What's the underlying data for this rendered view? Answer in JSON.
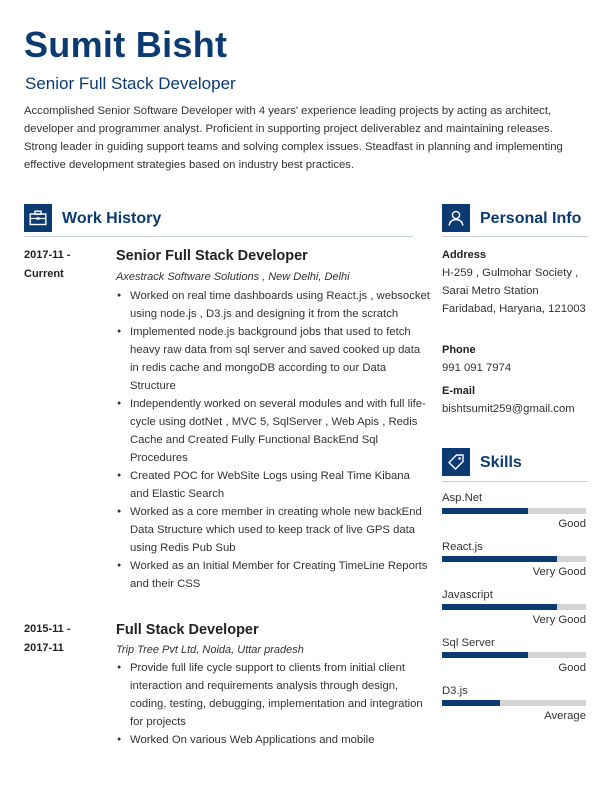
{
  "header": {
    "name": "Sumit Bisht",
    "title": "Senior Full Stack Developer",
    "summary": "Accomplished Senior Software Developer with 4 years' experience leading projects by acting as architect, developer and programmer analyst. Proficient in supporting project deliverablez and maintaining releases. Strong leader in guiding support teams and solving complex issues. Steadfast in planning and implementing effective development strategies based on industry best practices."
  },
  "work_history": {
    "heading": "Work History",
    "icon": "briefcase-icon",
    "jobs": [
      {
        "date_line1": "2017-11 -",
        "date_line2": "Current",
        "title": "Senior Full Stack Developer",
        "company": "Axestrack Software Solutions , New Delhi, Delhi",
        "bullets": [
          "Worked on real time dashboards using React.js , websocket using node.js , D3.js and designing it from the scratch",
          "Implemented node.js background jobs that used to fetch heavy raw data from sql server and saved cooked up data in redis cache and mongoDB according to our Data Structure",
          "Independently worked on several modules and with full life-cycle using dotNet , MVC 5, SqlServer , Web Apis , Redis Cache and Created Fully Functional BackEnd Sql Procedures",
          "Created POC for WebSite Logs using Real Time Kibana and Elastic Search",
          "Worked as a core member in creating whole new backEnd Data Structure which used to keep track of live GPS data using Redis Pub Sub",
          "Worked as an Initial Member for Creating TimeLine Reports and their CSS"
        ]
      },
      {
        "date_line1": "2015-11 -",
        "date_line2": "2017-11",
        "title": "Full Stack Developer",
        "company": "Trip Tree Pvt Ltd, Noida, Uttar pradesh",
        "bullets": [
          "Provide full life cycle support to clients from initial client interaction and requirements analysis through design, coding, testing, debugging, implementation and integration for projects",
          "Worked On various Web Applications and mobile"
        ]
      }
    ]
  },
  "personal_info": {
    "heading": "Personal Info",
    "icon": "user-icon",
    "address_label": "Address",
    "address_value": "H-259 , Gulmohar Society , Sarai Metro Station Faridabad, Haryana, 121003",
    "phone_label": "Phone",
    "phone_value": "991 091 7974",
    "email_label": "E-mail",
    "email_value": "bishtsumit259@gmail.com"
  },
  "skills": {
    "heading": "Skills",
    "icon": "tag-icon",
    "items": [
      {
        "name": "Asp.Net",
        "level": "Good",
        "fraction": 0.6
      },
      {
        "name": "React.js",
        "level": "Very Good",
        "fraction": 0.8
      },
      {
        "name": "Javascript",
        "level": "Very Good",
        "fraction": 0.8
      },
      {
        "name": "Sql Server",
        "level": "Good",
        "fraction": 0.6
      },
      {
        "name": "D3.js",
        "level": "Average",
        "fraction": 0.4
      }
    ]
  },
  "colors": {
    "accent": "#0c3b72",
    "track": "#d4d4d4",
    "rule": "#c7ced8"
  }
}
